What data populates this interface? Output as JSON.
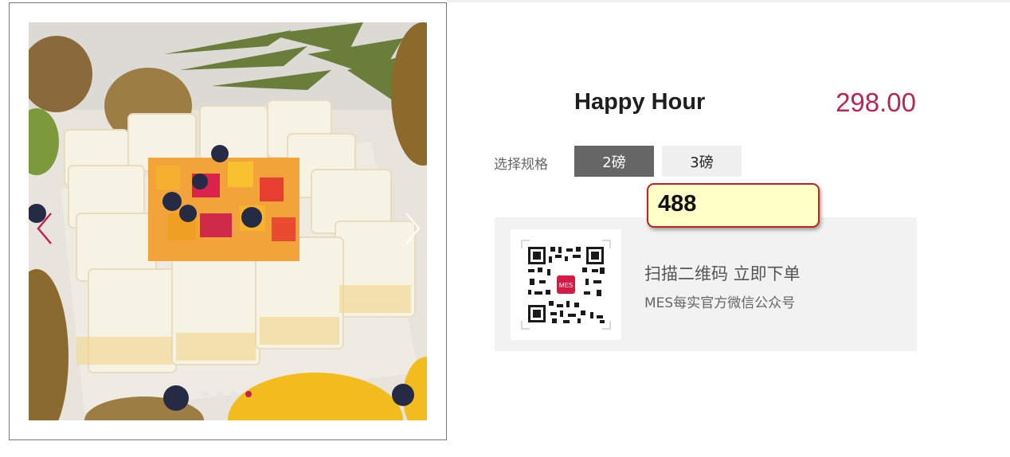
{
  "gallery": {
    "image_alt": "fruit cake",
    "slide_count": 4,
    "active_slide": 4
  },
  "product": {
    "title": "Happy Hour",
    "price": "298.00"
  },
  "spec": {
    "label": "选择规格",
    "options": [
      {
        "label": "2磅",
        "selected": true
      },
      {
        "label": "3磅",
        "selected": false
      }
    ]
  },
  "tooltip": {
    "value": "488"
  },
  "qr": {
    "logo_text": "MES",
    "title": "扫描二维码 立即下单",
    "subtitle": "MES每实官方微信公众号"
  },
  "colors": {
    "price": "#b8274f",
    "active_dot": "#c2244a",
    "selected_spec_bg": "#666666",
    "tooltip_bg": "#ffffc8",
    "tooltip_border": "#c52125"
  },
  "icons": [
    "chevron-left-icon",
    "chevron-right-icon",
    "qr-code-icon"
  ]
}
